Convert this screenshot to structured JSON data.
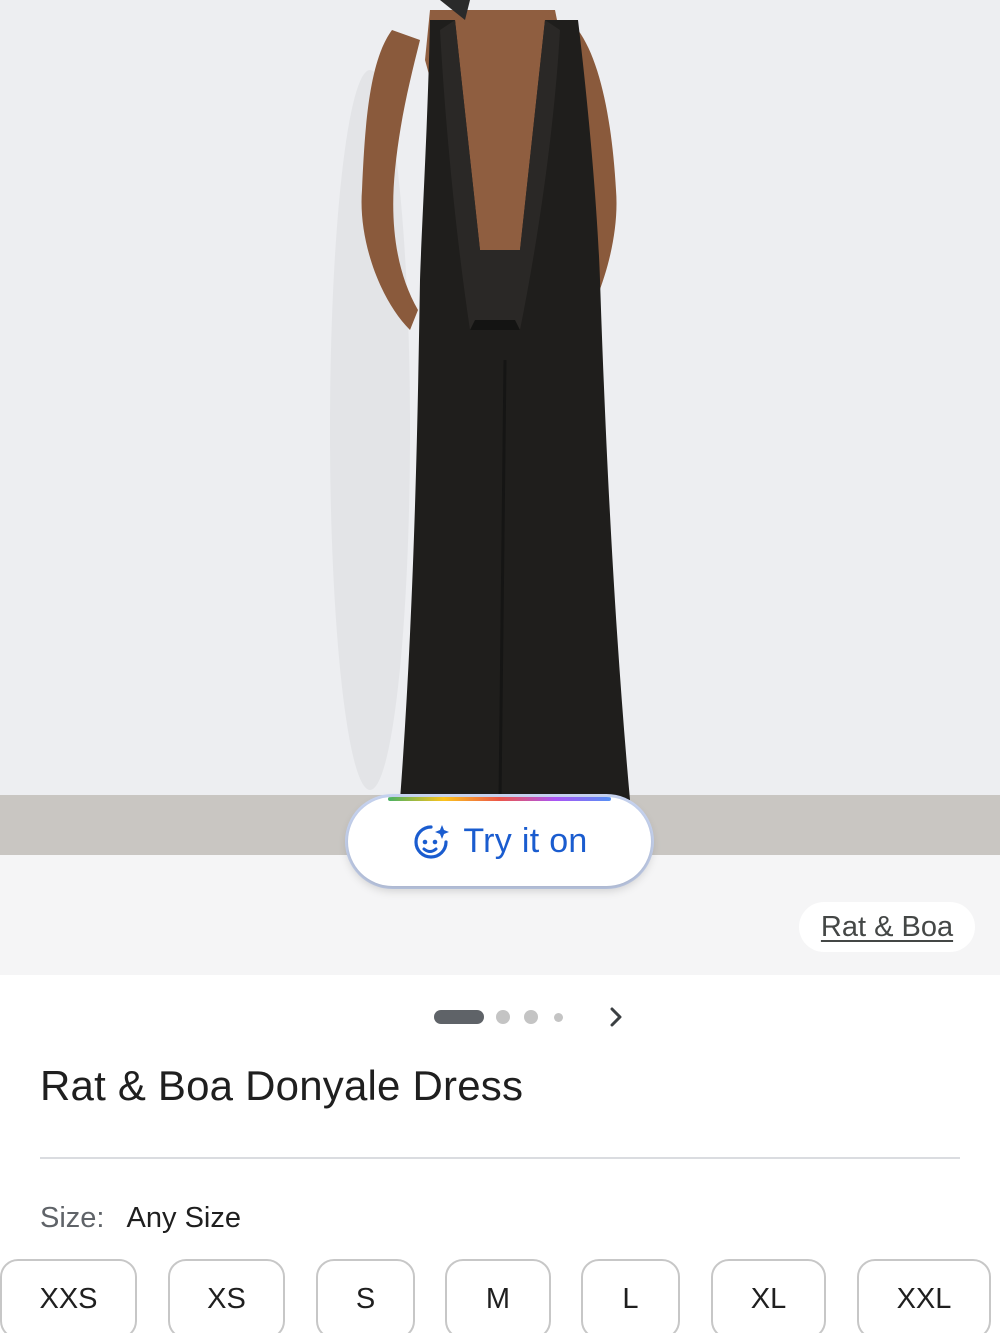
{
  "product": {
    "image_alt": "Model wearing black halter jumpsuit dress",
    "try_on": {
      "label": "Try it on",
      "icon": "face-sparkle-icon"
    },
    "brand_chip": "Rat & Boa",
    "carousel": {
      "dots": 4,
      "active_index": 0,
      "next_icon": "chevron-right-icon"
    },
    "title": "Rat & Boa Donyale Dress",
    "size": {
      "label": "Size:",
      "value": "Any Size",
      "options": [
        "XXS",
        "XS",
        "S",
        "M",
        "L",
        "XL",
        "XXL"
      ]
    }
  },
  "colors": {
    "accent_blue": "#1a5ccf",
    "text": "#1f1f1f",
    "muted": "#5f6368"
  }
}
